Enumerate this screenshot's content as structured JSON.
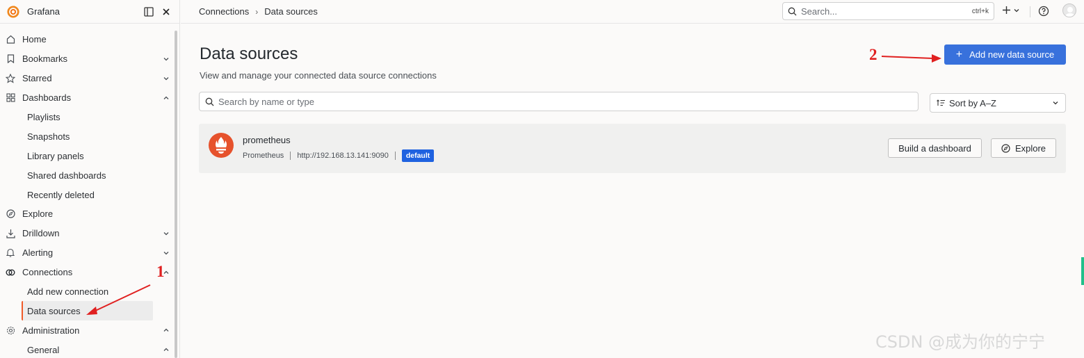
{
  "app": {
    "name": "Grafana"
  },
  "sidebar": {
    "items": [
      {
        "label": "Home",
        "icon": "home-icon",
        "chevron": ""
      },
      {
        "label": "Bookmarks",
        "icon": "bookmark-icon",
        "chevron": "down"
      },
      {
        "label": "Starred",
        "icon": "star-icon",
        "chevron": "down"
      },
      {
        "label": "Dashboards",
        "icon": "apps-icon",
        "chevron": "up"
      },
      {
        "label": "Playlists",
        "sub": true
      },
      {
        "label": "Snapshots",
        "sub": true
      },
      {
        "label": "Library panels",
        "sub": true
      },
      {
        "label": "Shared dashboards",
        "sub": true
      },
      {
        "label": "Recently deleted",
        "sub": true
      },
      {
        "label": "Explore",
        "icon": "compass-icon",
        "chevron": ""
      },
      {
        "label": "Drilldown",
        "icon": "drilldown-icon",
        "chevron": "down"
      },
      {
        "label": "Alerting",
        "icon": "bell-icon",
        "chevron": "down"
      },
      {
        "label": "Connections",
        "icon": "connections-icon",
        "chevron": "up"
      },
      {
        "label": "Add new connection",
        "sub": true
      },
      {
        "label": "Data sources",
        "sub": true,
        "active": true
      },
      {
        "label": "Administration",
        "icon": "cog-icon",
        "chevron": "up"
      },
      {
        "label": "General",
        "sub": true,
        "chevron": "up"
      }
    ]
  },
  "topbar": {
    "breadcrumb": [
      "Connections",
      "Data sources"
    ],
    "search_placeholder": "Search...",
    "search_shortcut": "ctrl+k"
  },
  "main": {
    "title": "Data sources",
    "subtitle": "View and manage your connected data source connections",
    "add_button_label": "Add new data source",
    "search_placeholder": "Search by name or type",
    "sort_label": "Sort by A–Z",
    "datasources": [
      {
        "name": "prometheus",
        "type": "Prometheus",
        "url": "http://192.168.13.141:9090",
        "badge": "default",
        "build_label": "Build a dashboard",
        "explore_label": "Explore"
      }
    ]
  },
  "annotations": {
    "one": "1",
    "two": "2"
  },
  "watermark": "CSDN @成为你的宁宁",
  "colors": {
    "accent": "#3871dc",
    "brand": "#f05a28",
    "badge": "#1f62e0",
    "annotation": "#e02020"
  }
}
